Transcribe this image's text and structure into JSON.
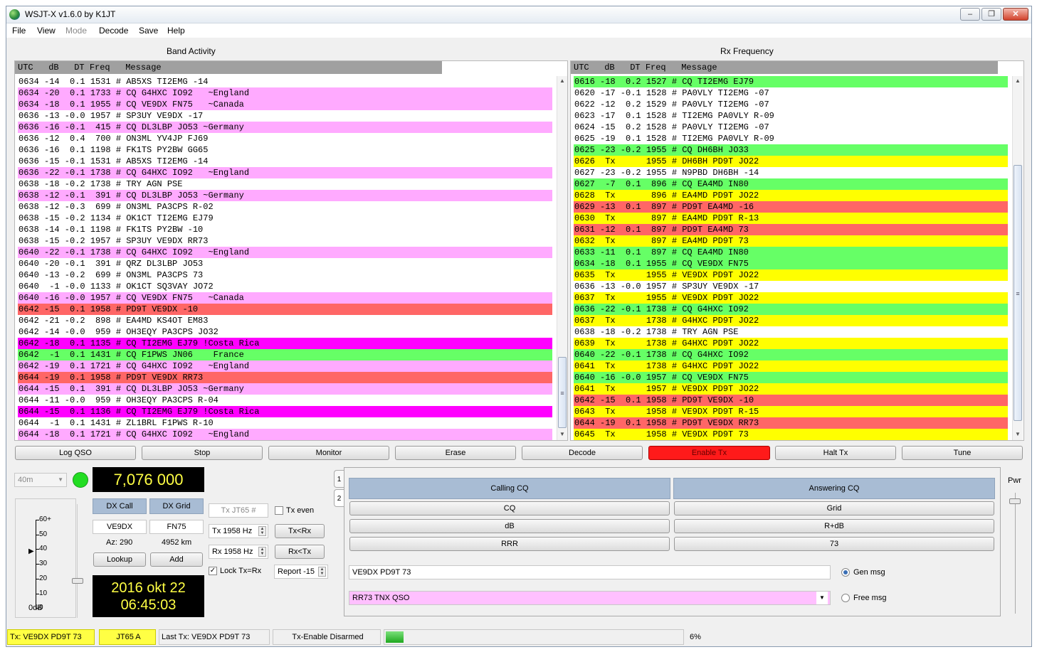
{
  "window": {
    "title": "WSJT-X   v1.6.0   by K1JT",
    "min": "‒",
    "max": "❐",
    "close": "✕"
  },
  "menu": [
    "File",
    "View",
    "Mode",
    "Decode",
    "Save",
    "Help"
  ],
  "band_activity": {
    "title": "Band Activity",
    "header": "UTC   dB   DT Freq   Message",
    "rows": [
      {
        "t": "0634 -14  0.1 1531 # AB5XS TI2EMG -14",
        "c": "#ffffff"
      },
      {
        "t": "0634 -20  0.1 1733 # CQ G4HXC IO92   ~England",
        "c": "#ffaaff"
      },
      {
        "t": "0634 -18  0.1 1955 # CQ VE9DX FN75   ~Canada",
        "c": "#ffaaff"
      },
      {
        "t": "0636 -13 -0.0 1957 # SP3UY VE9DX -17",
        "c": "#ffffff"
      },
      {
        "t": "0636 -16 -0.1  415 # CQ DL3LBP JO53 ~Germany",
        "c": "#ffaaff"
      },
      {
        "t": "0636 -12  0.4  700 # ON3ML YV4JP FJ69",
        "c": "#ffffff"
      },
      {
        "t": "0636 -16  0.1 1198 # FK1TS PY2BW GG65",
        "c": "#ffffff"
      },
      {
        "t": "0636 -15 -0.1 1531 # AB5XS TI2EMG -14",
        "c": "#ffffff"
      },
      {
        "t": "0636 -22 -0.1 1738 # CQ G4HXC IO92   ~England",
        "c": "#ffaaff"
      },
      {
        "t": "0638 -18 -0.2 1738 # TRY AGN PSE",
        "c": "#ffffff"
      },
      {
        "t": "0638 -12 -0.1  391 # CQ DL3LBP JO53 ~Germany",
        "c": "#ffaaff"
      },
      {
        "t": "0638 -12 -0.3  699 # ON3ML PA3CPS R-02",
        "c": "#ffffff"
      },
      {
        "t": "0638 -15 -0.2 1134 # OK1CT TI2EMG EJ79",
        "c": "#ffffff"
      },
      {
        "t": "0638 -14 -0.1 1198 # FK1TS PY2BW -10",
        "c": "#ffffff"
      },
      {
        "t": "0638 -15 -0.2 1957 # SP3UY VE9DX RR73",
        "c": "#ffffff"
      },
      {
        "t": "0640 -22 -0.1 1738 # CQ G4HXC IO92   ~England",
        "c": "#ffaaff"
      },
      {
        "t": "0640 -20 -0.1  391 # QRZ DL3LBP JO53",
        "c": "#ffffff"
      },
      {
        "t": "0640 -13 -0.2  699 # ON3ML PA3CPS 73",
        "c": "#ffffff"
      },
      {
        "t": "0640  -1 -0.0 1133 # OK1CT SQ3VAY JO72",
        "c": "#ffffff"
      },
      {
        "t": "0640 -16 -0.0 1957 # CQ VE9DX FN75   ~Canada",
        "c": "#ffaaff"
      },
      {
        "t": "0642 -15  0.1 1958 # PD9T VE9DX -10",
        "c": "#ff6666"
      },
      {
        "t": "0642 -21 -0.2  898 # EA4MD KS4OT EM83",
        "c": "#ffffff"
      },
      {
        "t": "0642 -14 -0.0  959 # OH3EQY PA3CPS JO32",
        "c": "#ffffff"
      },
      {
        "t": "0642 -18  0.1 1135 # CQ TI2EMG EJ79 !Costa Rica",
        "c": "#ff00ff"
      },
      {
        "t": "0642  -1  0.1 1431 # CQ F1PWS JN06    France",
        "c": "#66ff66"
      },
      {
        "t": "0642 -19  0.1 1721 # CQ G4HXC IO92   ~England",
        "c": "#ffaaff"
      },
      {
        "t": "0644 -19  0.1 1958 # PD9T VE9DX RR73",
        "c": "#ff6666"
      },
      {
        "t": "0644 -15  0.1  391 # CQ DL3LBP JO53 ~Germany",
        "c": "#ffaaff"
      },
      {
        "t": "0644 -11 -0.0  959 # OH3EQY PA3CPS R-04",
        "c": "#ffffff"
      },
      {
        "t": "0644 -15  0.1 1136 # CQ TI2EMG EJ79 !Costa Rica",
        "c": "#ff00ff"
      },
      {
        "t": "0644  -1  0.1 1431 # ZL1BRL F1PWS R-10",
        "c": "#ffffff"
      },
      {
        "t": "0644 -18  0.1 1721 # CQ G4HXC IO92   ~England",
        "c": "#ffaaff"
      }
    ]
  },
  "rx_frequency": {
    "title": "Rx Frequency",
    "header": "UTC   dB   DT Freq   Message",
    "rows": [
      {
        "t": "0616 -18  0.2 1527 # CQ TI2EMG EJ79",
        "c": "#66ff66"
      },
      {
        "t": "0620 -17 -0.1 1528 # PA0VLY TI2EMG -07",
        "c": "#ffffff"
      },
      {
        "t": "0622 -12  0.2 1529 # PA0VLY TI2EMG -07",
        "c": "#ffffff"
      },
      {
        "t": "0623 -17  0.1 1528 # TI2EMG PA0VLY R-09",
        "c": "#ffffff"
      },
      {
        "t": "0624 -15  0.2 1528 # PA0VLY TI2EMG -07",
        "c": "#ffffff"
      },
      {
        "t": "0625 -19  0.1 1528 # TI2EMG PA0VLY R-09",
        "c": "#ffffff"
      },
      {
        "t": "0625 -23 -0.2 1955 # CQ DH6BH JO33",
        "c": "#66ff66"
      },
      {
        "t": "0626  Tx      1955 # DH6BH PD9T JO22",
        "c": "#ffff00"
      },
      {
        "t": "0627 -23 -0.2 1955 # N9PBD DH6BH -14",
        "c": "#ffffff"
      },
      {
        "t": "0627  -7  0.1  896 # CQ EA4MD IN80",
        "c": "#66ff66"
      },
      {
        "t": "0628  Tx       896 # EA4MD PD9T JO22",
        "c": "#ffff00"
      },
      {
        "t": "0629 -13  0.1  897 # PD9T EA4MD -16",
        "c": "#ff6666"
      },
      {
        "t": "0630  Tx       897 # EA4MD PD9T R-13",
        "c": "#ffff00"
      },
      {
        "t": "0631 -12  0.1  897 # PD9T EA4MD 73",
        "c": "#ff6666"
      },
      {
        "t": "0632  Tx       897 # EA4MD PD9T 73",
        "c": "#ffff00"
      },
      {
        "t": "0633 -11  0.1  897 # CQ EA4MD IN80",
        "c": "#66ff66"
      },
      {
        "t": "0634 -18  0.1 1955 # CQ VE9DX FN75",
        "c": "#66ff66"
      },
      {
        "t": "0635  Tx      1955 # VE9DX PD9T JO22",
        "c": "#ffff00"
      },
      {
        "t": "0636 -13 -0.0 1957 # SP3UY VE9DX -17",
        "c": "#ffffff"
      },
      {
        "t": "0637  Tx      1955 # VE9DX PD9T JO22",
        "c": "#ffff00"
      },
      {
        "t": "0636 -22 -0.1 1738 # CQ G4HXC IO92",
        "c": "#66ff66"
      },
      {
        "t": "0637  Tx      1738 # G4HXC PD9T JO22",
        "c": "#ffff00"
      },
      {
        "t": "0638 -18 -0.2 1738 # TRY AGN PSE",
        "c": "#ffffff"
      },
      {
        "t": "0639  Tx      1738 # G4HXC PD9T JO22",
        "c": "#ffff00"
      },
      {
        "t": "0640 -22 -0.1 1738 # CQ G4HXC IO92",
        "c": "#66ff66"
      },
      {
        "t": "0641  Tx      1738 # G4HXC PD9T JO22",
        "c": "#ffff00"
      },
      {
        "t": "0640 -16 -0.0 1957 # CQ VE9DX FN75",
        "c": "#66ff66"
      },
      {
        "t": "0641  Tx      1957 # VE9DX PD9T JO22",
        "c": "#ffff00"
      },
      {
        "t": "0642 -15  0.1 1958 # PD9T VE9DX -10",
        "c": "#ff6666"
      },
      {
        "t": "0643  Tx      1958 # VE9DX PD9T R-15",
        "c": "#ffff00"
      },
      {
        "t": "0644 -19  0.1 1958 # PD9T VE9DX RR73",
        "c": "#ff6666"
      },
      {
        "t": "0645  Tx      1958 # VE9DX PD9T 73",
        "c": "#ffff00"
      }
    ]
  },
  "buttons": {
    "log_qso": "Log QSO",
    "stop": "Stop",
    "monitor": "Monitor",
    "erase": "Erase",
    "decode": "Decode",
    "enable_tx": "Enable Tx",
    "halt_tx": "Halt Tx",
    "tune": "Tune"
  },
  "band": "40m",
  "dial_freq": "7,076 000",
  "meter": {
    "ticks": [
      "60+",
      "50",
      "40",
      "30",
      "20",
      "10",
      "0"
    ],
    "unit": "0dB",
    "level_db": 38
  },
  "dx": {
    "call_label": "DX Call",
    "grid_label": "DX Grid",
    "call": "VE9DX",
    "grid": "FN75",
    "az": "Az: 290",
    "dist": "4952 km",
    "lookup": "Lookup",
    "add": "Add"
  },
  "datetime": {
    "date": "2016 okt 22",
    "time": "06:45:03"
  },
  "tx_controls": {
    "tx_mode": "Tx JT65  #",
    "tx_even": "Tx even",
    "tx_freq": "Tx  1958  Hz",
    "rx_freq": "Rx  1958  Hz",
    "tx_to_rx": "Tx<Rx",
    "rx_to_tx": "Rx<Tx",
    "lock": "Lock Tx=Rx",
    "report": "Report -15",
    "tabs": [
      "1",
      "2"
    ]
  },
  "messages": {
    "calling_cq": "Calling CQ",
    "answering_cq": "Answering CQ",
    "cq": "CQ",
    "grid": "Grid",
    "db": "dB",
    "rdb": "R+dB",
    "rrr": "RRR",
    "seventy_three": "73",
    "gen_msg_text": "VE9DX PD9T 73",
    "gen_msg": "Gen msg",
    "free_msg_text": "RR73 TNX QSO",
    "free_msg": "Free msg"
  },
  "pwr": "Pwr",
  "status": {
    "tx": "Tx: VE9DX PD9T 73",
    "mode": "JT65 A",
    "last_tx": "Last Tx:  VE9DX PD9T 73",
    "tx_enable": "Tx-Enable Disarmed",
    "progress": 0.06,
    "progress_label": "6%"
  }
}
